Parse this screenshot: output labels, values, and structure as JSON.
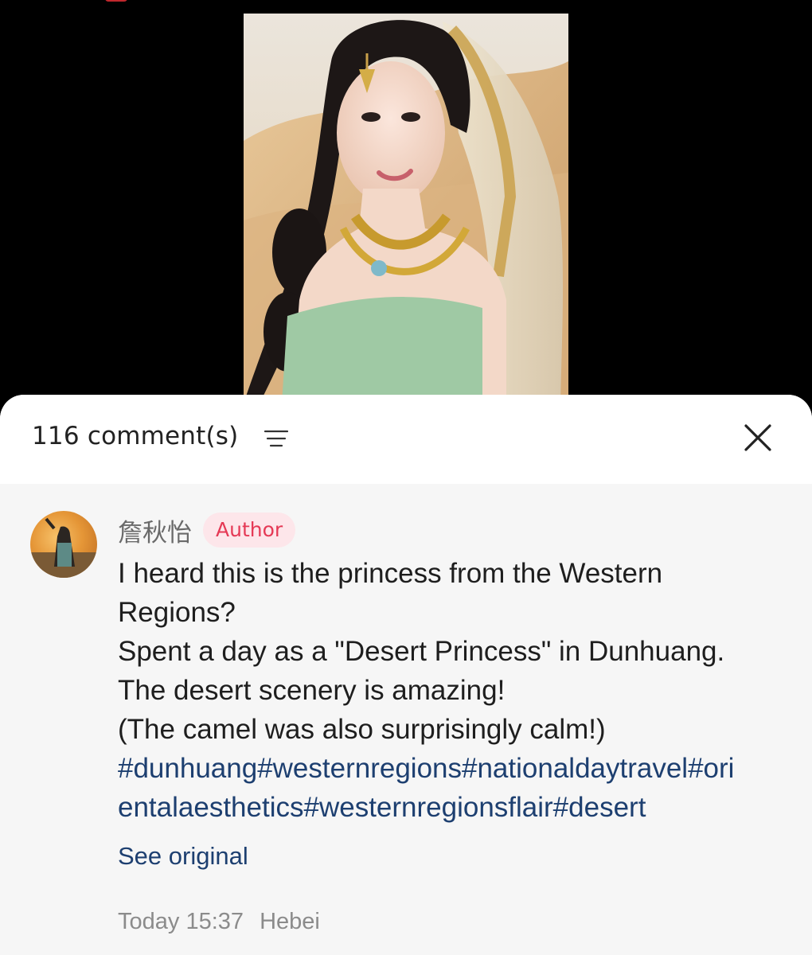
{
  "post": {
    "image": {
      "description_icon": "photo-icon"
    }
  },
  "comments_panel": {
    "count_label": "116 comment(s)",
    "sort_icon": "sort-icon",
    "close_icon": "close-icon"
  },
  "comment": {
    "author_name": "詹秋怡",
    "author_badge": "Author",
    "body_lines": [
      "I heard this is the princess from the Western",
      "Regions?",
      "Spent a day as a \"Desert Princess\" in Dunhuang.",
      "The desert scenery is amazing!",
      "(The camel was also surprisingly calm!)"
    ],
    "hashtag_lines": [
      "#dunhuang#westernregions#nationaldaytravel#ori",
      "entalaesthetics#westernregionsflair#desert"
    ],
    "see_original": "See original",
    "time": "Today 15:37",
    "location": "Hebei"
  },
  "colors": {
    "badge_text": "#e53955",
    "badge_bg": "#fde6ea",
    "link": "#1d3f70",
    "sheet_bg": "#f6f6f6"
  }
}
